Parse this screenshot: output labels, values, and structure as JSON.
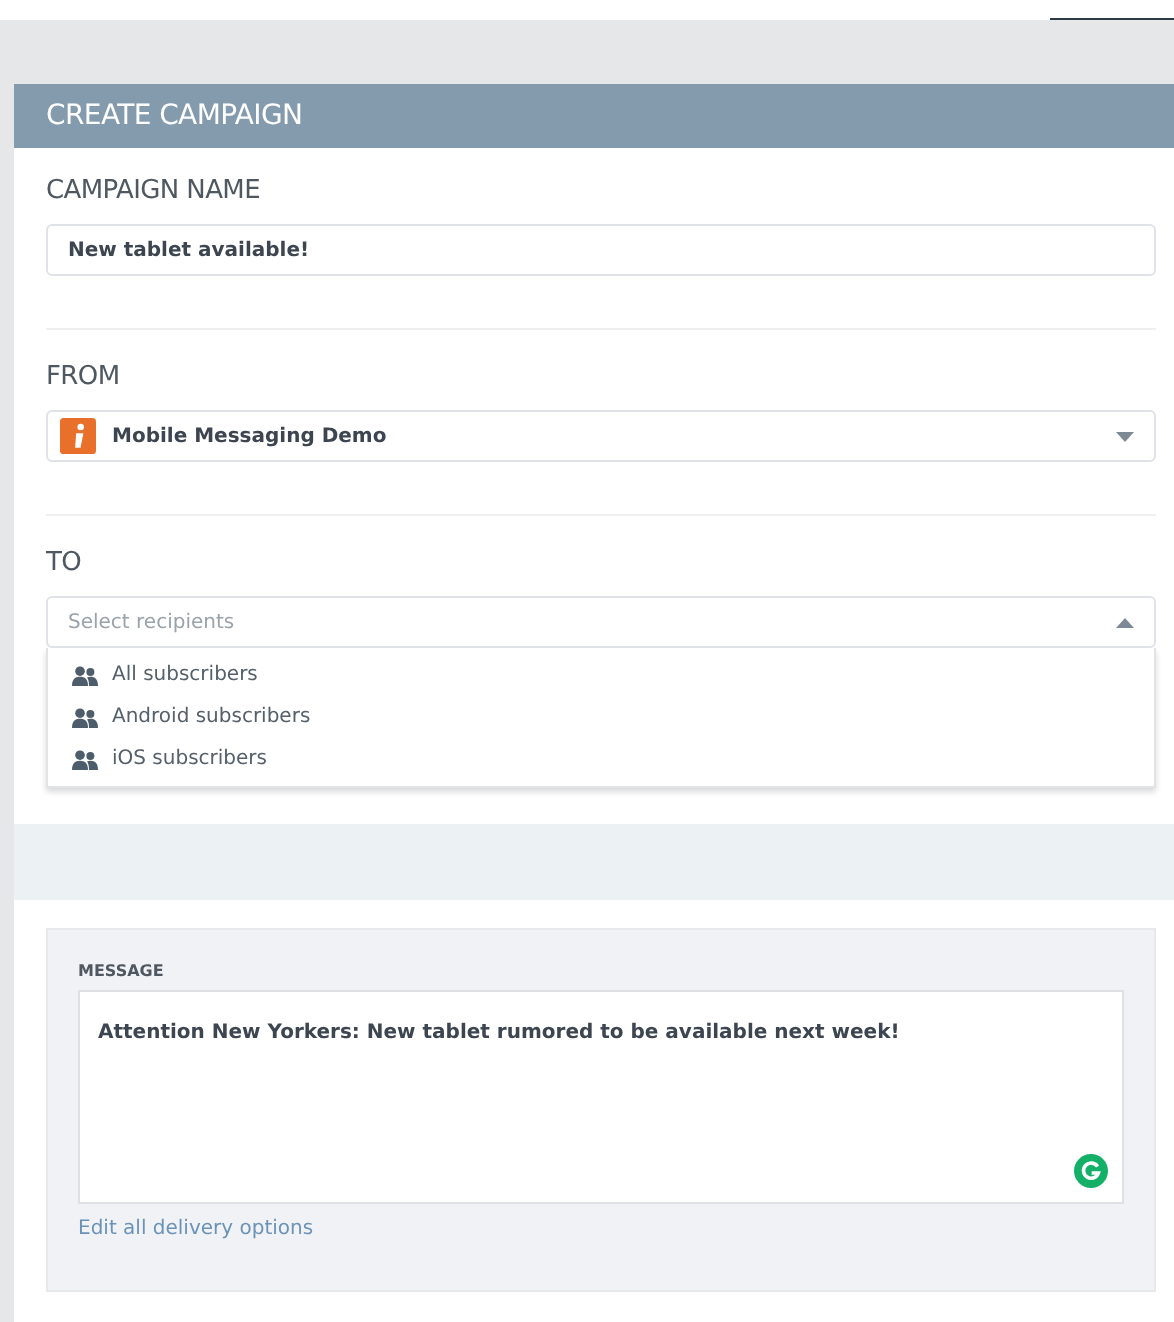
{
  "header": {
    "title": "CREATE CAMPAIGN"
  },
  "campaign_name": {
    "label": "CAMPAIGN NAME",
    "value": "New tablet available!"
  },
  "from": {
    "label": "FROM",
    "value": "Mobile Messaging Demo"
  },
  "to": {
    "label": "TO",
    "placeholder": "Select recipients",
    "expanded": true,
    "options": [
      {
        "label": "All subscribers"
      },
      {
        "label": "Android subscribers"
      },
      {
        "label": "iOS subscribers"
      }
    ]
  },
  "message": {
    "label": "MESSAGE",
    "value": "Attention New Yorkers: New tablet rumored to be available next week!",
    "link": "Edit all delivery options"
  }
}
